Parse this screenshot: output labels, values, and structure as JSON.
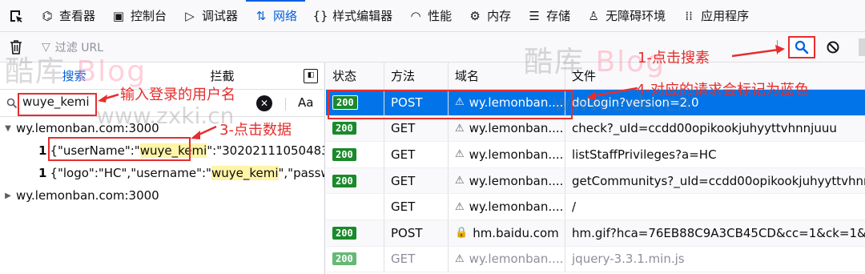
{
  "tabs": [
    {
      "label": "查看器",
      "icon": "inspector-icon"
    },
    {
      "label": "控制台",
      "icon": "console-icon"
    },
    {
      "label": "调试器",
      "icon": "debugger-icon"
    },
    {
      "label": "网络",
      "icon": "network-icon"
    },
    {
      "label": "样式编辑器",
      "icon": "style-editor-icon"
    },
    {
      "label": "性能",
      "icon": "performance-icon"
    },
    {
      "label": "内存",
      "icon": "memory-icon"
    },
    {
      "label": "存储",
      "icon": "storage-icon"
    },
    {
      "label": "无障碍环境",
      "icon": "accessibility-icon"
    },
    {
      "label": "应用程序",
      "icon": "application-icon"
    }
  ],
  "toolbar": {
    "filter_placeholder": "过滤 URL"
  },
  "left_panel": {
    "tab_search": "搜索",
    "tab_block": "拦截",
    "search_value": "wuye_kemi",
    "case_label": "Aa",
    "results": [
      {
        "host": "wy.lemonban.com:3000",
        "expanded": true
      },
      {
        "line": "1",
        "pre": "{\"userName\":\"",
        "match": "wuye_kemi",
        "post": "\":\"302021110504836..."
      },
      {
        "line": "1",
        "pre": "{\"logo\":\"HC\",\"username\":\"",
        "match": "wuye_kemi",
        "post": "\",\"passwd..."
      },
      {
        "host": "wy.lemonban.com:3000",
        "expanded": false
      }
    ]
  },
  "table": {
    "headers": [
      "状态",
      "方法",
      "域名",
      "文件"
    ],
    "rows": [
      {
        "status": "200",
        "method": "POST",
        "domain": "wy.lemonban....",
        "file": "doLogin?version=2.0",
        "secure": false
      },
      {
        "status": "200",
        "method": "GET",
        "domain": "wy.lemonban....",
        "file": "check?_uId=ccdd00opikookjuhyyttvhnnjuuu",
        "secure": false
      },
      {
        "status": "200",
        "method": "GET",
        "domain": "wy.lemonban....",
        "file": "listStaffPrivileges?a=HC",
        "secure": false
      },
      {
        "status": "200",
        "method": "GET",
        "domain": "wy.lemonban....",
        "file": "getCommunitys?_uId=ccdd00opikookjuhyyttvhnn",
        "secure": false
      },
      {
        "status": "",
        "method": "GET",
        "domain": "wy.lemonban....",
        "file": "/",
        "secure": false
      },
      {
        "status": "200",
        "method": "POST",
        "domain": "hm.baidu.com",
        "file": "hm.gif?hca=76EB88C9A3CB45CD&cc=1&ck=1&cl",
        "secure": true
      },
      {
        "status": "200",
        "method": "GET",
        "domain": "wy.lemonban....",
        "file": "jquery-3.3.1.min.js",
        "secure": false
      }
    ]
  },
  "annotations": {
    "a1": "1-点击搜素",
    "a2": "输入登录的用户名",
    "a3": "3-点击数据",
    "a4": "4-对应的请求会标记为蓝色"
  },
  "watermark": {
    "cn": "酷库",
    "blog": "Blog",
    "url": "www.zxki.cn"
  },
  "colors": {
    "accent": "#0060df",
    "selected_row": "#0074e8",
    "status_ok": "#1a8a2a",
    "annotation": "#e52e2e",
    "highlight": "#fff4a8"
  }
}
